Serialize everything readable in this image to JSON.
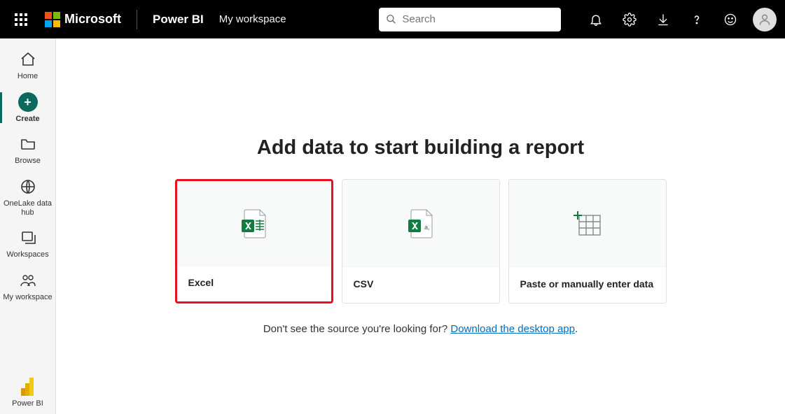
{
  "header": {
    "brand": "Microsoft",
    "app": "Power BI",
    "workspace": "My workspace",
    "search_placeholder": "Search"
  },
  "sidebar": {
    "items": [
      {
        "id": "home",
        "label": "Home"
      },
      {
        "id": "create",
        "label": "Create"
      },
      {
        "id": "browse",
        "label": "Browse"
      },
      {
        "id": "onelake",
        "label": "OneLake data hub"
      },
      {
        "id": "workspaces",
        "label": "Workspaces"
      },
      {
        "id": "myworkspace",
        "label": "My workspace"
      }
    ],
    "footer_label": "Power BI"
  },
  "main": {
    "title": "Add data to start building a report",
    "cards": [
      {
        "id": "excel",
        "label": "Excel",
        "selected": true
      },
      {
        "id": "csv",
        "label": "CSV",
        "selected": false
      },
      {
        "id": "paste",
        "label": "Paste or manually enter data",
        "selected": false
      }
    ],
    "help_text": "Don't see the source you're looking for? ",
    "help_link": "Download the desktop app",
    "help_suffix": "."
  }
}
